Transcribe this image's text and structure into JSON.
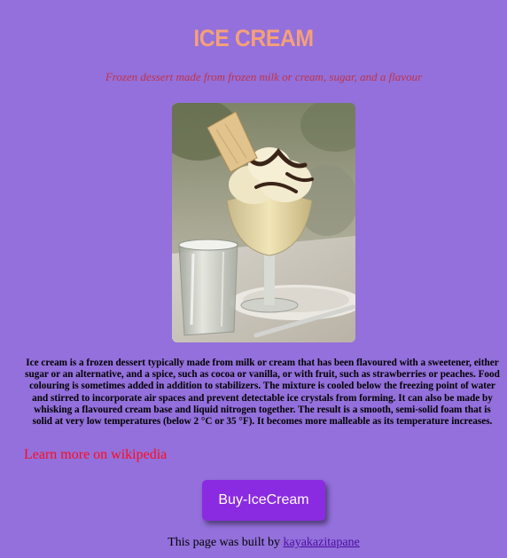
{
  "page": {
    "title": "ICE CREAM",
    "subtitle": "Frozen dessert made from frozen milk or cream, sugar, and a flavour",
    "image": {
      "subject": "ice cream sundae in a glass goblet with a wafer and chocolate sauce, next to a drinking glass"
    },
    "description": "Ice cream is a frozen dessert typically made from milk or cream that has been flavoured with a sweetener, either sugar or an alternative, and a spice, such as cocoa or vanilla, or with fruit, such as strawberries or peaches. Food colouring is sometimes added in addition to stabilizers. The mixture is cooled below the freezing point of water and stirred to incorporate air spaces and prevent detectable ice crystals from forming. It can also be made by whisking a flavoured cream base and liquid nitrogen together. The result is a smooth, semi-solid foam that is solid at very low temperatures (below 2 °C or 35 °F). It becomes more malleable as its temperature increases.",
    "wiki_link_label": "Learn more on wikipedia",
    "buy_button_label": "Buy-IceCream",
    "footer_prefix": "This page was built by ",
    "footer_author": "kayakazitapane"
  },
  "colors": {
    "background": "#9370db",
    "title": "#f4a07a",
    "subtitle": "#c0334a",
    "link": "#ff0a1e",
    "button": "#8a2be2",
    "author_link": "#4b0ca0"
  }
}
